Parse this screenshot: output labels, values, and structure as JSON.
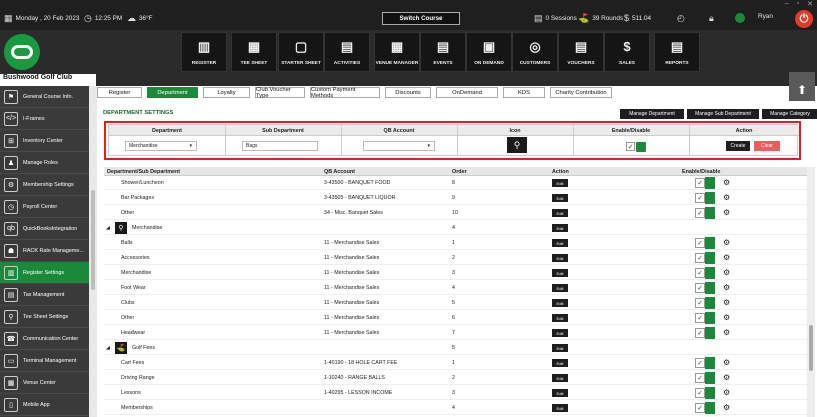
{
  "window_controls": [
    "–",
    "▫",
    "✕"
  ],
  "topbar": {
    "date": "Monday , 20 Feb 2023",
    "time": "12:25 PM",
    "weather": "36°F",
    "switch_course": "Switch Course",
    "sessions": "0 Sessions",
    "rounds": "39 Rounds",
    "amount": "511.04",
    "user": "Ryan"
  },
  "club_name": "Bushwood Golf Club",
  "nav": [
    "REGISTER",
    "TEE SHEET",
    "STARTER SHEET",
    "ACTIVITIES",
    "VENUE MANAGER",
    "EVENTS",
    "ON DEMAND",
    "CUSTOMERS",
    "VOUCHERS",
    "SALES",
    "REPORTS"
  ],
  "sidebar": [
    {
      "label": "General Course Info.",
      "icon": "flag-icon"
    },
    {
      "label": "I-Frames",
      "icon": "code-icon"
    },
    {
      "label": "Inventory Center",
      "icon": "boxes-icon"
    },
    {
      "label": "Manage Roles",
      "icon": "roles-icon"
    },
    {
      "label": "Membership Settings",
      "icon": "gear-icon"
    },
    {
      "label": "Payroll Center",
      "icon": "clock-icon"
    },
    {
      "label": "QuickBooksIntegration",
      "icon": "quickbooks-icon"
    },
    {
      "label": "RACK Rate Manageme...",
      "icon": "rack-rate-icon"
    },
    {
      "label": "Register Settings",
      "icon": "register-icon"
    },
    {
      "label": "Tax Management",
      "icon": "tax-icon"
    },
    {
      "label": "Tee Sheet Settings",
      "icon": "tee-icon"
    },
    {
      "label": "Communication Center",
      "icon": "communication-icon"
    },
    {
      "label": "Terminal Management",
      "icon": "terminal-icon"
    },
    {
      "label": "Venue Center",
      "icon": "venue-icon"
    },
    {
      "label": "Mobile App",
      "icon": "mobile-icon"
    }
  ],
  "tabs": [
    "Register",
    "Department",
    "Loyalty",
    "Club Voucher Type",
    "Custom Payment Methods",
    "Discounts",
    "OnDemand",
    "KDS",
    "Charity Contribution"
  ],
  "department": {
    "title": "DEPARTMENT SETTINGS",
    "buttons": [
      "Manage Department",
      "Manage Sub Department",
      "Manage Category"
    ],
    "form": {
      "headers": [
        "Department",
        "Sub Department",
        "QB Account",
        "Icon",
        "Enable/Disable",
        "Action"
      ],
      "department_value": "Merchandise",
      "sub_department_value": "Bags",
      "qb_account_value": "",
      "create": "Create",
      "clear": "Clear"
    }
  },
  "table": {
    "headers": [
      "Department/Sub Department",
      "QB Account",
      "Order",
      "Action",
      "Enable/Disable"
    ],
    "edit_label": "Edit",
    "rows": [
      {
        "type": "sub",
        "name": "Shower/Luncheon",
        "qb": "3-43500 - BANQUET FOOD",
        "order": "8"
      },
      {
        "type": "sub",
        "name": "Bar Packages",
        "qb": "3-43505 - BANQUET LIQUOR",
        "order": "9"
      },
      {
        "type": "sub",
        "name": "Other",
        "qb": "34 - Misc. Banquet Sales",
        "order": "10"
      },
      {
        "type": "group",
        "name": "Merchandise",
        "qb": "",
        "order": "4"
      },
      {
        "type": "sub",
        "name": "Balls",
        "qb": "11 - Merchandise Sales",
        "order": "1"
      },
      {
        "type": "sub",
        "name": "Accessories",
        "qb": "11 - Merchandise Sales",
        "order": "2"
      },
      {
        "type": "sub",
        "name": "Merchandise",
        "qb": "11 - Merchandise Sales",
        "order": "3"
      },
      {
        "type": "sub",
        "name": "Foot Wear",
        "qb": "11 - Merchandise Sales",
        "order": "4"
      },
      {
        "type": "sub",
        "name": "Clubs",
        "qb": "11 - Merchandise Sales",
        "order": "5"
      },
      {
        "type": "sub",
        "name": "Other",
        "qb": "11 - Merchandise Sales",
        "order": "6"
      },
      {
        "type": "sub",
        "name": "Headwear",
        "qb": "11 - Merchandise Sales",
        "order": "7"
      },
      {
        "type": "group",
        "name": "Golf Fees",
        "qb": "",
        "order": "5"
      },
      {
        "type": "sub",
        "name": "Cart Fees",
        "qb": "1-40190 - 18 HOLE CART FEE",
        "order": "1"
      },
      {
        "type": "sub",
        "name": "Driving Range",
        "qb": "1-10240 - RANGE BALLS",
        "order": "2"
      },
      {
        "type": "sub",
        "name": "Lessons",
        "qb": "1-40295 - LESSON INCOME",
        "order": "3"
      },
      {
        "type": "sub",
        "name": "Memberships",
        "qb": "",
        "order": "4"
      }
    ]
  },
  "colors": {
    "accent": "#1a8a3a",
    "dark": "#1e1e1e",
    "alert": "#e23b2a",
    "highlight": "#e02020"
  }
}
